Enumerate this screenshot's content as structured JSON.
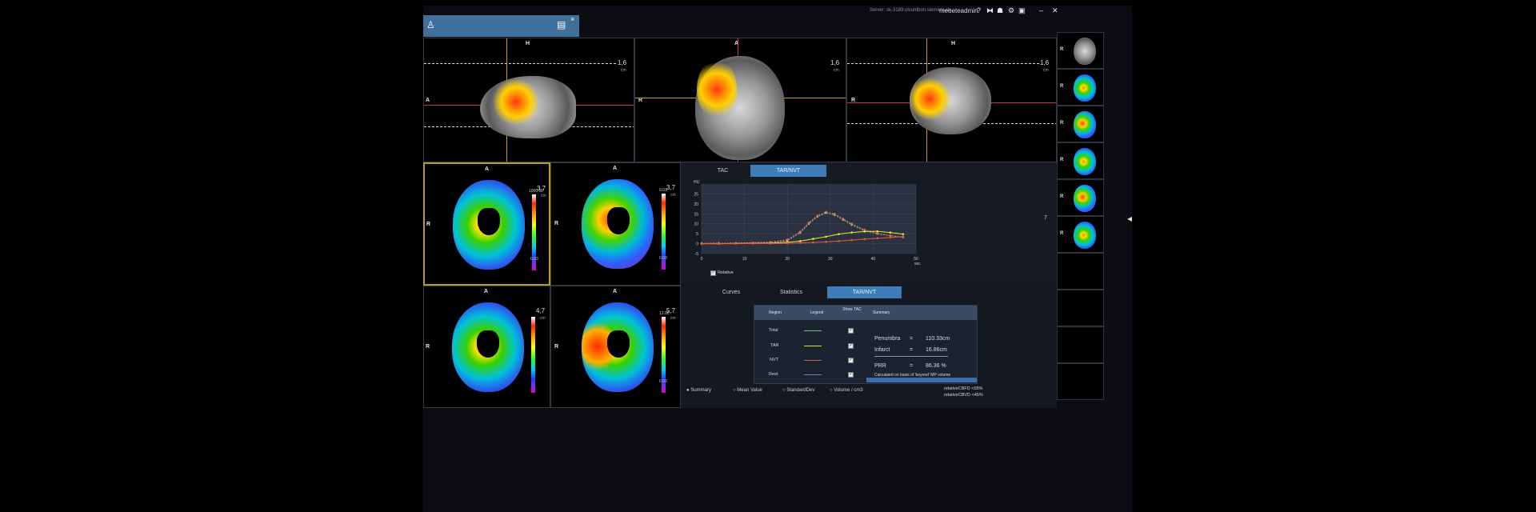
{
  "topbar": {
    "server": "Server: sk-3189.ulcuntbon.siemens.de",
    "user": "meoeteadmin",
    "icons": [
      "help-icon",
      "split-icon",
      "users-icon",
      "settings-icon",
      "briefcase-icon",
      "minimize-icon",
      "close-icon"
    ]
  },
  "tab": {
    "person_icon": "person-icon",
    "save_icon": "save-icon",
    "close": "×"
  },
  "orientation": {
    "H": "H",
    "A": "A",
    "R": "R"
  },
  "mpr_views": [
    {
      "scale": "1,6",
      "unit": "cm"
    },
    {
      "scale": "1,6",
      "unit": "cm"
    },
    {
      "scale": "1,6",
      "unit": "cm"
    }
  ],
  "maps": [
    {
      "scale": "3,7",
      "unit": "cm",
      "cmax": "1000.00",
      "cmin": "0.03"
    },
    {
      "scale": "3,7",
      "unit": "cm",
      "cmax": "0.03",
      "cmin": "0.03"
    },
    {
      "scale": "4,7",
      "unit": "cm",
      "cmax": "",
      "cmin": ""
    },
    {
      "scale": "5,7",
      "unit": "cm",
      "cmax": "12.00",
      "cmin": "0.03"
    }
  ],
  "tac_tabs": [
    "TAC",
    "TAR/NVT"
  ],
  "chart_data": {
    "type": "line",
    "title": "",
    "ylabel": "HU",
    "xlabel": "sec",
    "xlim": [
      0,
      50
    ],
    "ylim": [
      -5,
      30
    ],
    "x_ticks": [
      "0",
      "10",
      "20",
      "30",
      "40",
      "50"
    ],
    "y_ticks": [
      "25",
      "20",
      "15",
      "10",
      "5",
      "0",
      "-5"
    ],
    "series": [
      {
        "color": "#7fc97f",
        "x": [
          0,
          4,
          8,
          12,
          16,
          20,
          23,
          25,
          27,
          29,
          31,
          33,
          35,
          38,
          41,
          44,
          47
        ],
        "values": [
          0.2,
          0.2,
          0.3,
          0.3,
          0.5,
          1.5,
          5.5,
          10,
          13.5,
          15.5,
          14.5,
          12,
          9.5,
          6.5,
          5,
          4,
          3.2
        ]
      },
      {
        "color": "#ff6060",
        "x": [
          0,
          4,
          8,
          12,
          16,
          20,
          23,
          25,
          27,
          29,
          31,
          33,
          35,
          38,
          41,
          44,
          47
        ],
        "values": [
          0.2,
          0.3,
          0.3,
          0.5,
          0.8,
          2,
          6,
          10.5,
          14,
          16,
          15,
          12.5,
          10,
          7,
          5.2,
          4,
          3.3
        ]
      },
      {
        "color": "#e8e830",
        "x": [
          0,
          4,
          8,
          12,
          16,
          20,
          23,
          26,
          29,
          32,
          35,
          38,
          41,
          44,
          47
        ],
        "values": [
          0,
          0,
          0.1,
          0.2,
          0.3,
          0.7,
          1.3,
          2.4,
          3.5,
          4.8,
          5.6,
          6.1,
          6.2,
          5.6,
          4.8
        ]
      },
      {
        "color": "#e65a3c",
        "x": [
          0,
          4,
          8,
          12,
          16,
          20,
          23,
          26,
          29,
          32,
          35,
          38,
          41,
          44,
          47
        ],
        "values": [
          0,
          0,
          0,
          0.1,
          0.1,
          0.2,
          0.4,
          0.6,
          0.9,
          1.3,
          1.8,
          2.3,
          2.7,
          3.1,
          3.6
        ]
      }
    ]
  },
  "relative_label": "Relative",
  "right_readout": "7",
  "bottom_tabs": [
    "Curves",
    "Statistics",
    "TAR/NVT"
  ],
  "table": {
    "headers": [
      "Region",
      "Legend",
      "Show TAC",
      "Summary"
    ],
    "rows": [
      {
        "region": "Total",
        "legend_color": "#6fbf6f"
      },
      {
        "region": "TAR",
        "legend_color": "#e0e030"
      },
      {
        "region": "NVT",
        "legend_color": "#e05a3c"
      },
      {
        "region": "Rest",
        "legend_color": "#6f7fbf"
      }
    ],
    "check": "✓"
  },
  "summary": {
    "penumbra_label": "Penumbra",
    "penumbra_eq": "=",
    "penumbra_val": "110.33cm",
    "infarct_label": "Infarct",
    "infarct_eq": "=",
    "infarct_val": "16.86cm",
    "prr_label": "PRR",
    "prr_eq": "=",
    "prr_val": "86.36 %",
    "note": "Calculated on basis of 'beyond' MP volume"
  },
  "radios": [
    "Summary",
    "Mean Value",
    "StandardDev",
    "Volume / cm3"
  ],
  "footer": {
    "line1": "relativeCBFD <55%",
    "line2": "relativeCBVD <45%"
  }
}
